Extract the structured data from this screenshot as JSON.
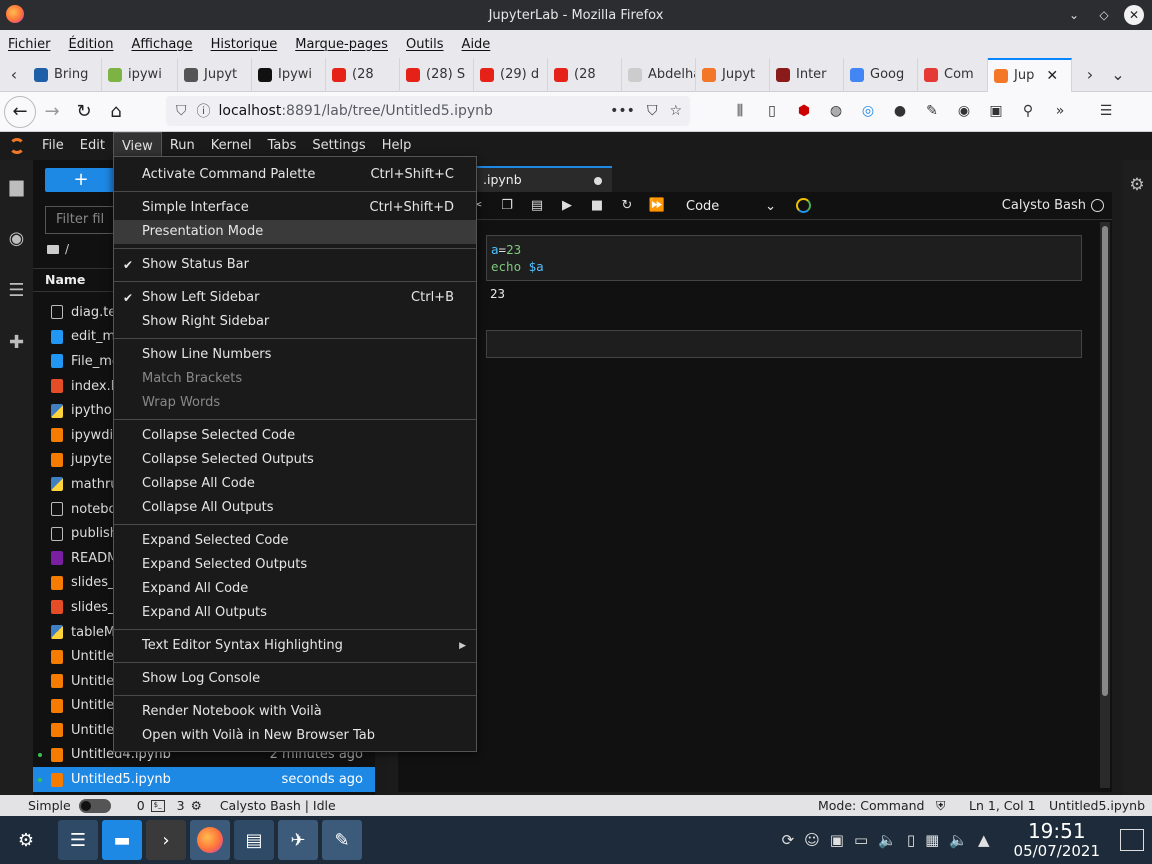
{
  "window": {
    "title": "JupyterLab - Mozilla Firefox"
  },
  "firefox_menu": [
    "Fichier",
    "Édition",
    "Affichage",
    "Historique",
    "Marque-pages",
    "Outils",
    "Aide"
  ],
  "tabs": [
    {
      "label": "Bring",
      "color": "#1f5fa8"
    },
    {
      "label": "ipywi",
      "color": "#7cb342"
    },
    {
      "label": "Jupyt",
      "color": "#555555"
    },
    {
      "label": "Ipywi",
      "color": "#111111"
    },
    {
      "label": "(28",
      "color": "#e62117"
    },
    {
      "label": "(28) S",
      "color": "#e62117"
    },
    {
      "label": "(29) d",
      "color": "#e62117"
    },
    {
      "label": "(28",
      "color": "#e62117"
    },
    {
      "label": "Abdelhal",
      "color": "#cccccc"
    },
    {
      "label": "Jupyt",
      "color": "#f37726"
    },
    {
      "label": "Inter",
      "color": "#8b1a1a"
    },
    {
      "label": "Goog",
      "color": "#4285f4"
    },
    {
      "label": "Com",
      "color": "#e53935"
    },
    {
      "label": "Jup",
      "color": "#f37726"
    }
  ],
  "url": {
    "host": "localhost",
    "path": ":8891/lab/tree/Untitled5.ipynb"
  },
  "jupyter_menu": [
    "File",
    "Edit",
    "View",
    "Run",
    "Kernel",
    "Tabs",
    "Settings",
    "Help"
  ],
  "filebrowser": {
    "filter_placeholder": "Filter fil",
    "breadcrumb": "/",
    "name_header": "Name",
    "files": [
      {
        "name": "diag.tex",
        "type": "file",
        "modified": ""
      },
      {
        "name": "edit_me",
        "type": "img",
        "modified": ""
      },
      {
        "name": "File_me",
        "type": "img",
        "modified": ""
      },
      {
        "name": "index.ht",
        "type": "html",
        "modified": ""
      },
      {
        "name": "ipython_",
        "type": "py",
        "modified": ""
      },
      {
        "name": "ipywdig",
        "type": "nb",
        "modified": ""
      },
      {
        "name": "jupyterN",
        "type": "nb",
        "modified": ""
      },
      {
        "name": "mathrul",
        "type": "py",
        "modified": ""
      },
      {
        "name": "noteboo",
        "type": "file",
        "modified": ""
      },
      {
        "name": "publish.",
        "type": "file",
        "modified": ""
      },
      {
        "name": "READM",
        "type": "md",
        "modified": ""
      },
      {
        "name": "slides_c",
        "type": "nb",
        "modified": ""
      },
      {
        "name": "slides_c",
        "type": "html",
        "modified": ""
      },
      {
        "name": "tableMa",
        "type": "py",
        "modified": ""
      },
      {
        "name": "Untitled",
        "type": "nb",
        "modified": ""
      },
      {
        "name": "Untitled",
        "type": "nb",
        "modified": ""
      },
      {
        "name": "Untitled",
        "type": "nb",
        "modified": ""
      },
      {
        "name": "Untitled",
        "type": "nb",
        "modified": ""
      },
      {
        "name": "Untitled4.ipynb",
        "type": "nb",
        "modified": "2 minutes ago",
        "running": true
      },
      {
        "name": "Untitled5.ipynb",
        "type": "nb",
        "modified": "seconds ago",
        "running": true,
        "selected": true
      }
    ]
  },
  "notebook": {
    "tab_label": ".ipynb",
    "cell_type": "Code",
    "kernel": "Calysto Bash",
    "cell1_line1_var": "a",
    "cell1_line1_eq": "=",
    "cell1_line1_num": "23",
    "cell1_line2_kw": "echo",
    "cell1_line2_var": "$a",
    "output": "23"
  },
  "view_menu": [
    {
      "label": "Activate Command Palette",
      "shortcut": "Ctrl+Shift+C"
    },
    {
      "sep": true
    },
    {
      "label": "Simple Interface",
      "shortcut": "Ctrl+Shift+D"
    },
    {
      "label": "Presentation Mode",
      "highlight": true
    },
    {
      "sep": true
    },
    {
      "label": "Show Status Bar",
      "checked": true
    },
    {
      "sep": true
    },
    {
      "label": "Show Left Sidebar",
      "shortcut": "Ctrl+B",
      "checked": true
    },
    {
      "label": "Show Right Sidebar"
    },
    {
      "sep": true
    },
    {
      "label": "Show Line Numbers"
    },
    {
      "label": "Match Brackets",
      "disabled": true
    },
    {
      "label": "Wrap Words",
      "disabled": true
    },
    {
      "sep": true
    },
    {
      "label": "Collapse Selected Code"
    },
    {
      "label": "Collapse Selected Outputs"
    },
    {
      "label": "Collapse All Code"
    },
    {
      "label": "Collapse All Outputs"
    },
    {
      "sep": true
    },
    {
      "label": "Expand Selected Code"
    },
    {
      "label": "Expand Selected Outputs"
    },
    {
      "label": "Expand All Code"
    },
    {
      "label": "Expand All Outputs"
    },
    {
      "sep": true
    },
    {
      "label": "Text Editor Syntax Highlighting",
      "submenu": true
    },
    {
      "sep": true
    },
    {
      "label": "Show Log Console"
    },
    {
      "sep": true
    },
    {
      "label": "Render Notebook with Voilà"
    },
    {
      "label": "Open with Voilà in New Browser Tab"
    }
  ],
  "statusbar": {
    "simple_label": "Simple",
    "count1": "0",
    "count2": "3",
    "kernel_status": "Calysto Bash | Idle",
    "mode": "Mode: Command",
    "position": "Ln 1, Col 1",
    "file": "Untitled5.ipynb"
  },
  "taskbar": {
    "time": "19:51",
    "date": "05/07/2021"
  }
}
